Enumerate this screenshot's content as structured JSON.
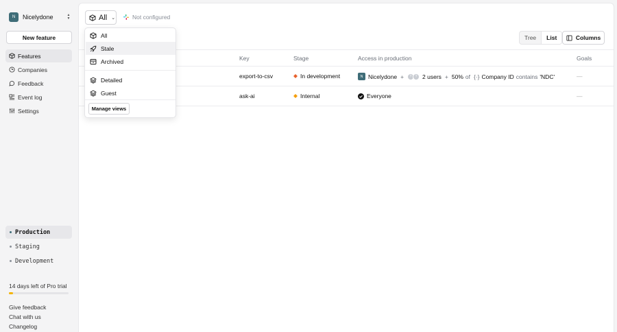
{
  "sidebar": {
    "org": {
      "initial": "N",
      "name": "Nicelydone"
    },
    "new_feature_label": "New feature",
    "nav": [
      {
        "label": "Features",
        "icon": "box-icon",
        "active": true
      },
      {
        "label": "Companies",
        "icon": "clock-icon"
      },
      {
        "label": "Feedback",
        "icon": "chat-icon"
      },
      {
        "label": "Event log",
        "icon": "log-icon"
      },
      {
        "label": "Settings",
        "icon": "sliders-icon"
      }
    ],
    "environments": [
      {
        "label": "Production",
        "active": true
      },
      {
        "label": "Staging"
      },
      {
        "label": "Development"
      }
    ],
    "trial": {
      "text": "14 days left of Pro trial",
      "progress": 0.07
    },
    "footer_links": [
      "Give feedback",
      "Chat with us",
      "Changelog"
    ]
  },
  "toolbar": {
    "view_label": "All",
    "slack_status": "Not configured",
    "view_toggle": [
      "Tree",
      "List"
    ],
    "active_toggle": "List",
    "columns_label": "Columns"
  },
  "table": {
    "headers": {
      "key": "Key",
      "stage": "Stage",
      "access": "Access in production",
      "goals": "Goals"
    },
    "rows": [
      {
        "key": "export-to-csv",
        "stage": "In development",
        "access": {
          "company_initial": "N",
          "company": "Nicelydone",
          "plus1": "+",
          "users": "2 users",
          "plus2": "+",
          "percent": "50%",
          "of": "of",
          "attr_symbol": "{·}",
          "attr": "Company ID",
          "op": "contains",
          "value": "'NDC'"
        },
        "goals": "—"
      },
      {
        "key": "ask-ai",
        "stage": "Internal",
        "access": {
          "everyone": "Everyone"
        },
        "goals": "—"
      }
    ]
  },
  "dropdown": {
    "items": [
      {
        "label": "All",
        "icon": "box-icon"
      },
      {
        "label": "Stale",
        "icon": "rocket-icon",
        "highlighted": true
      },
      {
        "label": "Archived",
        "icon": "archive-icon"
      },
      {
        "label": "Detailed",
        "icon": "layers-icon"
      },
      {
        "label": "Guest",
        "icon": "layers-icon"
      }
    ],
    "manage_label": "Manage views"
  },
  "colors": {
    "accent": "#3f6d78",
    "stage_dev": "#e8612c",
    "stage_internal": "#f59e0b",
    "trial": "#f4b400"
  }
}
